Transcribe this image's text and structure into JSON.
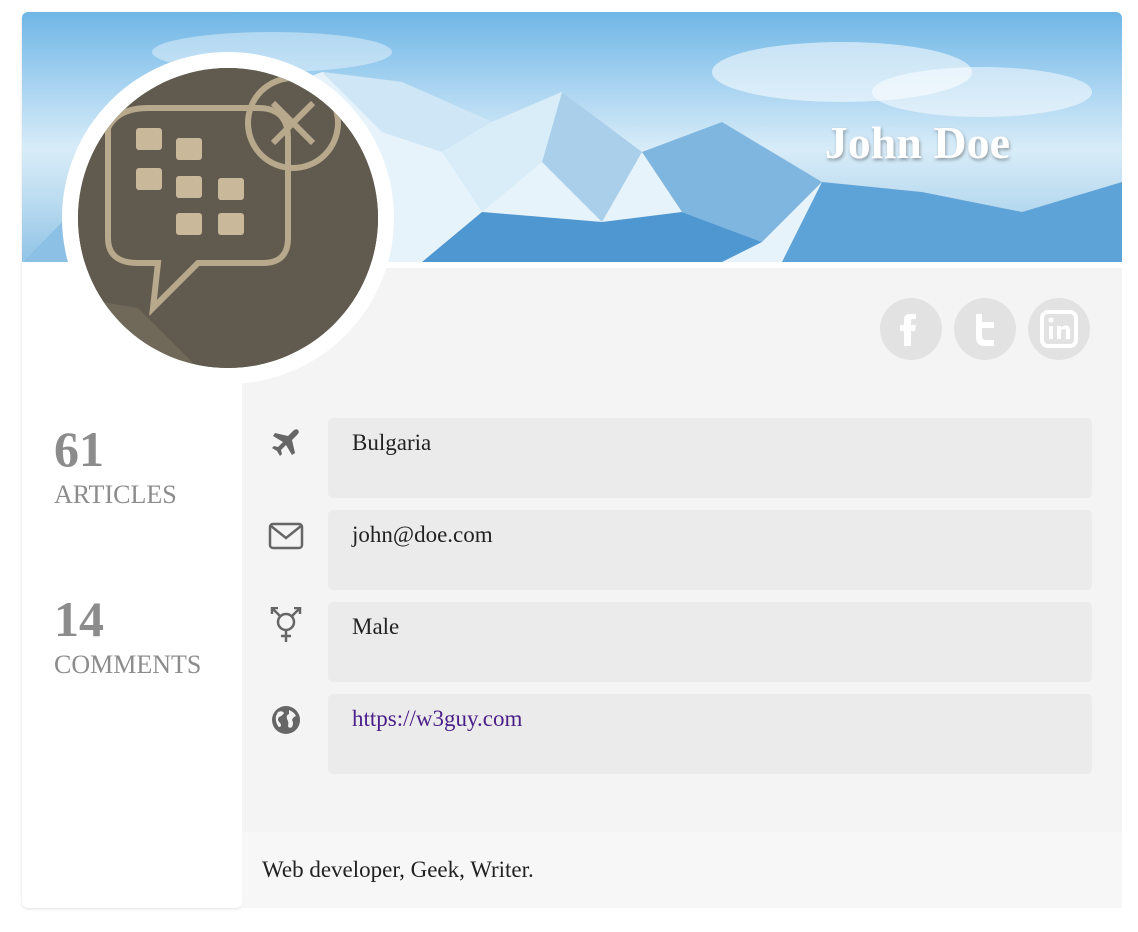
{
  "profile": {
    "name": "John Doe",
    "bio": "Web developer, Geek, Writer."
  },
  "stats": [
    {
      "value": "61",
      "label": "ARTICLES"
    },
    {
      "value": "14",
      "label": "COMMENTS"
    }
  ],
  "info": {
    "country": "Bulgaria",
    "email": "john@doe.com",
    "gender": "Male",
    "website": "https://w3guy.com"
  },
  "social": [
    {
      "icon": "facebook-icon",
      "glyph": "f"
    },
    {
      "icon": "twitter-icon",
      "glyph": "t"
    },
    {
      "icon": "linkedin-icon",
      "glyph": "in"
    }
  ],
  "colors": {
    "link": "#4b1f8a",
    "stat": "#8c8c8c",
    "panel": "#f4f4f4",
    "field": "#ebebeb",
    "social": "#e2e2e2"
  }
}
